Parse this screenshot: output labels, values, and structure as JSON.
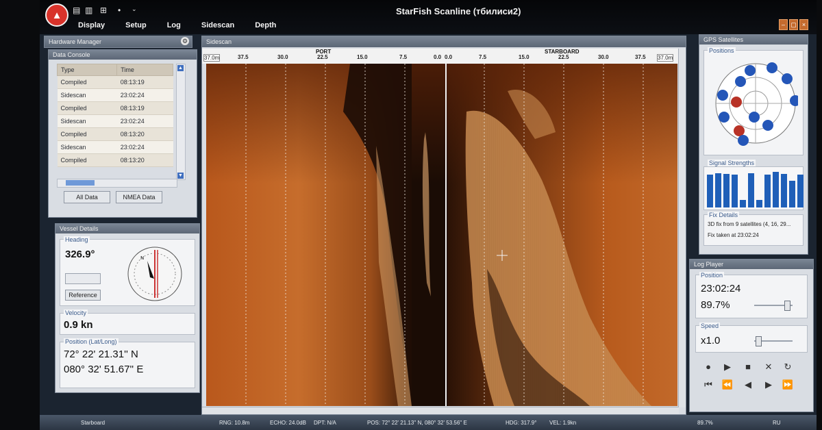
{
  "app": {
    "title": "StarFish Scanline (тбилиси2)"
  },
  "menu": [
    "Display",
    "Setup",
    "Log",
    "Sidescan",
    "Depth"
  ],
  "panels": {
    "hardware": "Hardware Manager",
    "data_console": "Data Console",
    "sidescan": "Sidescan",
    "gps": "GPS Satellites",
    "vessel": "Vessel Details",
    "log_player": "Log Player"
  },
  "data_console": {
    "columns": [
      "Type",
      "Time"
    ],
    "rows": [
      [
        "Compiled",
        "08:13:19"
      ],
      [
        "Sidescan",
        "23:02:24"
      ],
      [
        "Compiled",
        "08:13:19"
      ],
      [
        "Sidescan",
        "23:02:24"
      ],
      [
        "Compiled",
        "08:13:20"
      ],
      [
        "Sidescan",
        "23:02:24"
      ],
      [
        "Compiled",
        "08:13:20"
      ]
    ],
    "buttons": [
      "All Data",
      "NMEA Data"
    ]
  },
  "vessel": {
    "heading_label": "Heading",
    "heading": "326.9°",
    "reference_btn": "Reference",
    "velocity_label": "Velocity",
    "velocity": "0.9 kn",
    "position_label": "Position (Lat/Long)",
    "lat": "72° 22' 21.31'' N",
    "lon": "080° 32' 51.67'' E"
  },
  "sidescan": {
    "port_label": "PORT",
    "starboard_label": "STARBOARD",
    "range_left": "37.0m",
    "range_right": "37.0m",
    "ticks_port": [
      "37.5",
      "30.0",
      "22.5",
      "15.0",
      "7.5",
      "0.0"
    ],
    "ticks_starboard": [
      "0.0",
      "7.5",
      "15.0",
      "22.5",
      "30.0",
      "37.5"
    ],
    "colors": {
      "dark": "#241005",
      "mid": "#7a3a12",
      "bright": "#c86a24"
    }
  },
  "gps": {
    "positions_label": "Positions",
    "signal_label": "Signal Strengths",
    "fix_label": "Fix Details",
    "fix_line1": "3D fix from 9 satellites (4, 16, 29...",
    "fix_line2": "Fix taken at 23:02:24",
    "signal_levels": [
      0.85,
      0.9,
      0.88,
      0.85,
      0.2,
      0.9,
      0.2,
      0.85,
      0.92,
      0.88,
      0.7,
      0.85
    ]
  },
  "log_player": {
    "position_label": "Position",
    "time": "23:02:24",
    "percent": "89.7%",
    "position_fraction": 0.9,
    "speed_label": "Speed",
    "speed": "x1.0"
  },
  "status": {
    "starboard": "Starboard",
    "rng": "RNG: 10.8m",
    "echo": "ECHO: 24.0dB",
    "dpt": "DPT: N/A",
    "pos": "POS: 72° 22' 21.13'' N, 080° 32' 53.56'' E",
    "hdg": "HDG: 317.9°",
    "vel": "VEL: 1.9kn",
    "pct": "89.7%",
    "lang": "RU"
  }
}
